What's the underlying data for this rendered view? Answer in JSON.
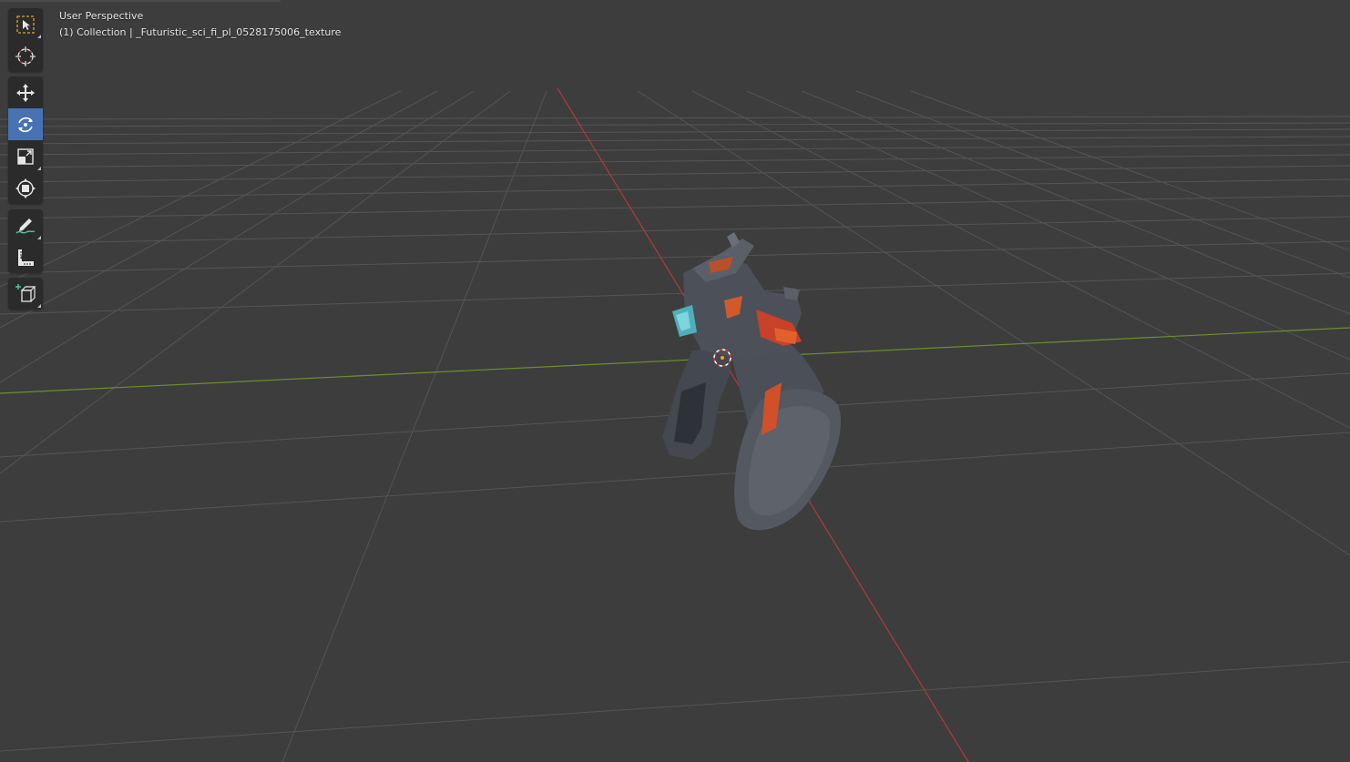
{
  "viewport": {
    "view_name": "User Perspective",
    "collection_line": "(1) Collection | _Futuristic_sci_fi_pl_0528175006_texture"
  },
  "toolbar": {
    "tools": [
      {
        "name": "select-box",
        "icon": "select-box-icon",
        "active": false
      },
      {
        "name": "cursor",
        "icon": "3d-cursor-icon",
        "active": false
      },
      {
        "name": "move",
        "icon": "move-arrows-icon",
        "active": false
      },
      {
        "name": "rotate",
        "icon": "rotate-icon",
        "active": true
      },
      {
        "name": "scale",
        "icon": "scale-icon",
        "active": false
      },
      {
        "name": "transform",
        "icon": "transform-icon",
        "active": false
      },
      {
        "name": "annotate",
        "icon": "annotate-pencil-icon",
        "active": false
      },
      {
        "name": "measure",
        "icon": "measure-ruler-icon",
        "active": false
      },
      {
        "name": "add-cube",
        "icon": "add-cube-icon",
        "active": false
      }
    ]
  },
  "colors": {
    "background": "#3d3d3d",
    "grid_line": "#555555",
    "x_axis": "#b53a3e",
    "y_axis": "#6d8f2e",
    "active_tool": "#4772b3",
    "toolbar_bg": "#2b2b2b"
  }
}
